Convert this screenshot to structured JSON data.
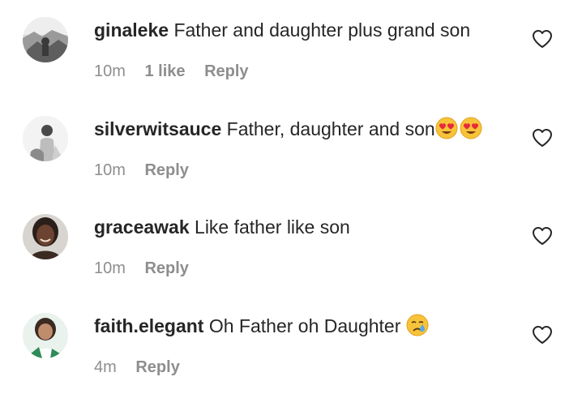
{
  "comments": [
    {
      "username": "ginaleke",
      "text": "Father and daughter plus grand son",
      "time": "10m",
      "likes": "1 like",
      "reply": "Reply"
    },
    {
      "username": "silverwitsauce",
      "text": "Father, daughter and son",
      "time": "10m",
      "reply": "Reply",
      "emoji": "heart-eyes-icon"
    },
    {
      "username": "graceawak",
      "text": "Like father like son",
      "time": "10m",
      "reply": "Reply"
    },
    {
      "username": "faith.elegant",
      "text": "Oh Father oh Daughter ",
      "time": "4m",
      "reply": "Reply",
      "emoji": "crying-face-icon"
    }
  ],
  "icons": {
    "like": "heart-outline-icon"
  },
  "colors": {
    "text": "#262626",
    "secondary": "#8e8e8e"
  }
}
